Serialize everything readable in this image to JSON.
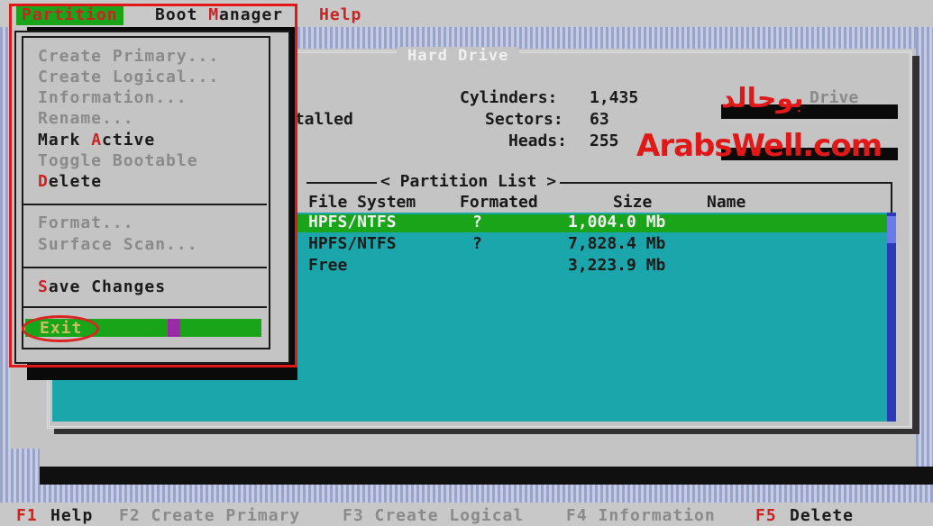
{
  "menu": {
    "partition": "Partition",
    "boot_manager_pre": "Boot ",
    "boot_manager_hot": "M",
    "boot_manager_post": "anager",
    "help": "Help"
  },
  "dropdown": {
    "create_primary": "Create Primary...",
    "create_logical": "Create Logical...",
    "information": "Information...",
    "rename": "Rename...",
    "mark_active_pre": "Mark ",
    "mark_active_hot": "A",
    "mark_active_post": "ctive",
    "toggle_bootable": "Toggle Bootable",
    "delete_hot": "D",
    "delete_post": "elete",
    "format": "Format...",
    "surface_scan": "Surface Scan...",
    "save_hot": "S",
    "save_post": "ave Changes",
    "exit": "Exit"
  },
  "drive": {
    "title": "Hard Drive",
    "partial_installed": "stalled",
    "partial_t": "t",
    "cylinders_label": "Cylinders:",
    "cylinders_value": "1,435",
    "sectors_label": "Sectors:",
    "sectors_value": "63",
    "heads_label": "Heads:",
    "heads_value": "255",
    "partial_drive": "Drive"
  },
  "partition_list": {
    "title": "< Partition List >",
    "headers": [
      "File System",
      "Formated",
      "Size",
      "Name"
    ],
    "rows": [
      {
        "fs": "HPFS/NTFS",
        "formatted": "?",
        "size": "1,004.0 Mb",
        "name": ""
      },
      {
        "fs": "HPFS/NTFS",
        "formatted": "?",
        "size": "7,828.4 Mb",
        "name": ""
      },
      {
        "fs": "Free",
        "formatted": "",
        "size": "3,223.9 Mb",
        "name": ""
      }
    ]
  },
  "status_bar": {
    "f1": "F1",
    "f1_label": "Help",
    "f2": "F2 Create Primary",
    "f3": "F3 Create Logical",
    "f4": "F4 Information",
    "f5": "F5",
    "f5_label": "Delete"
  },
  "watermark": {
    "arabic": "بوحالد",
    "latin": "ArabsWell.com"
  },
  "colors": {
    "selection_green": "#1aa41a",
    "list_teal": "#1aa6aa",
    "hotkey_red": "#cc2222",
    "annotation_red": "#e01818"
  }
}
